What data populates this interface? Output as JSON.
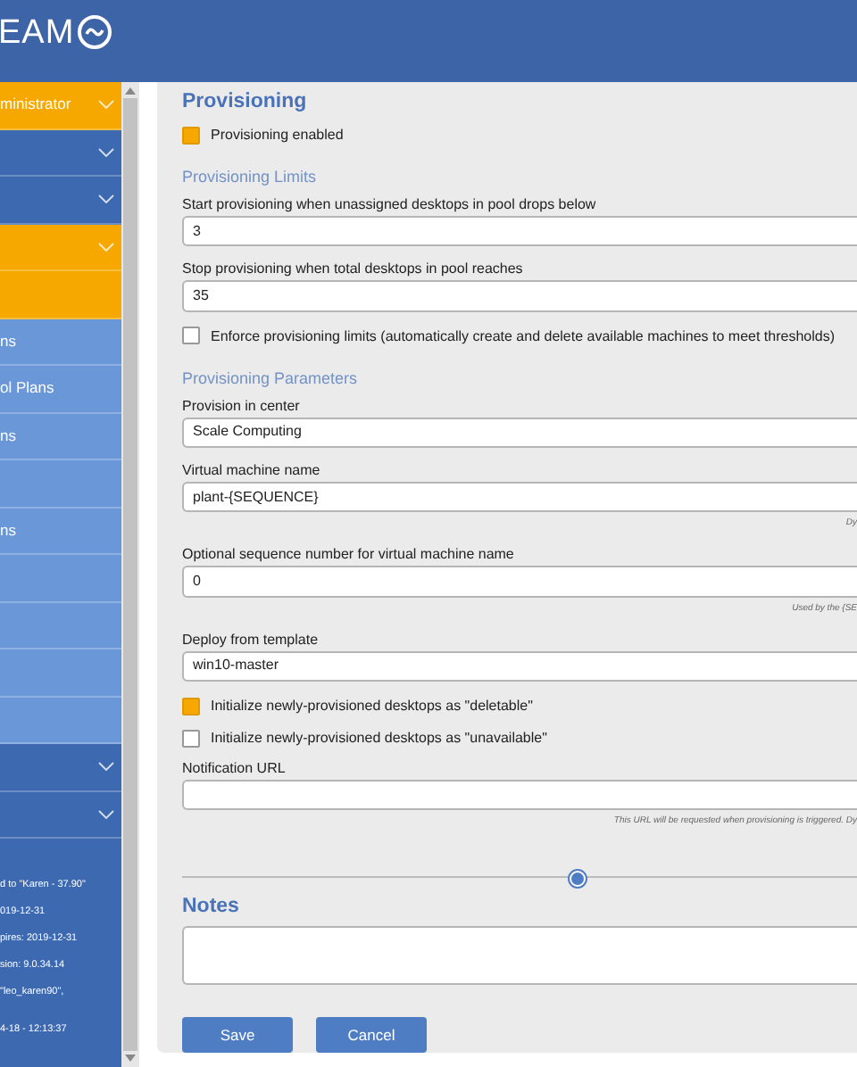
{
  "header": {
    "logo_text": "EAM"
  },
  "sidebar": {
    "items": [
      {
        "label": "ministrator",
        "kind": "group",
        "selected": true
      },
      {
        "kind": "group",
        "selected": false
      },
      {
        "kind": "group",
        "selected": false
      },
      {
        "kind": "group",
        "selected": true,
        "children": [
          {
            "selected": true
          },
          {
            "label": "ns",
            "selected": false
          },
          {
            "label": "ol Plans",
            "selected": false
          },
          {
            "label": "ns",
            "selected": false
          },
          {
            "selected": false
          },
          {
            "label": "ns",
            "selected": false
          },
          {
            "selected": false
          },
          {
            "selected": false
          },
          {
            "selected": false
          },
          {
            "selected": false
          }
        ]
      },
      {
        "kind": "group",
        "selected": false
      },
      {
        "kind": "group",
        "selected": false
      }
    ],
    "info_lines": [
      "d to \"Karen - 37.90\"",
      "019-12-31",
      "pires: 2019-12-31",
      "sion: 9.0.34.14",
      " \"leo_karen90\",",
      "4-18 - 12:13:37"
    ]
  },
  "form": {
    "title": "Provisioning",
    "rows": [
      {
        "kind": "checkbox",
        "label": "Provisioning enabled",
        "checked": true
      },
      {
        "kind": "subheading",
        "text": "Provisioning Limits"
      },
      {
        "kind": "field",
        "label": "Start provisioning when unassigned desktops in pool drops below",
        "value": "3"
      },
      {
        "kind": "field",
        "label": "Stop provisioning when total desktops in pool reaches",
        "value": "35"
      },
      {
        "kind": "checkbox",
        "label": "Enforce provisioning limits (automatically create and delete available machines to meet thresholds)",
        "checked": false
      },
      {
        "kind": "subheading",
        "text": "Provisioning Parameters"
      },
      {
        "kind": "field",
        "label": "Provision in center",
        "value": "Scale Computing"
      },
      {
        "kind": "field",
        "label": "Virtual machine name",
        "value": "plant-{SEQUENCE}",
        "help": "Dy"
      },
      {
        "kind": "field",
        "label": "Optional sequence number for virtual machine name",
        "value": "0",
        "help": "Used by the {SE"
      },
      {
        "kind": "field",
        "label": "Deploy from template",
        "value": "win10-master"
      },
      {
        "kind": "checkbox",
        "label": "Initialize newly-provisioned desktops as \"deletable\"",
        "checked": true
      },
      {
        "kind": "checkbox",
        "label": "Initialize newly-provisioned desktops as \"unavailable\"",
        "checked": false
      },
      {
        "kind": "field",
        "label": "Notification URL",
        "help": "This URL will be requested when provisioning is triggered. Dy"
      }
    ],
    "notes_title": "Notes",
    "buttons": [
      {
        "label": "Save"
      },
      {
        "label": "Cancel"
      }
    ]
  }
}
